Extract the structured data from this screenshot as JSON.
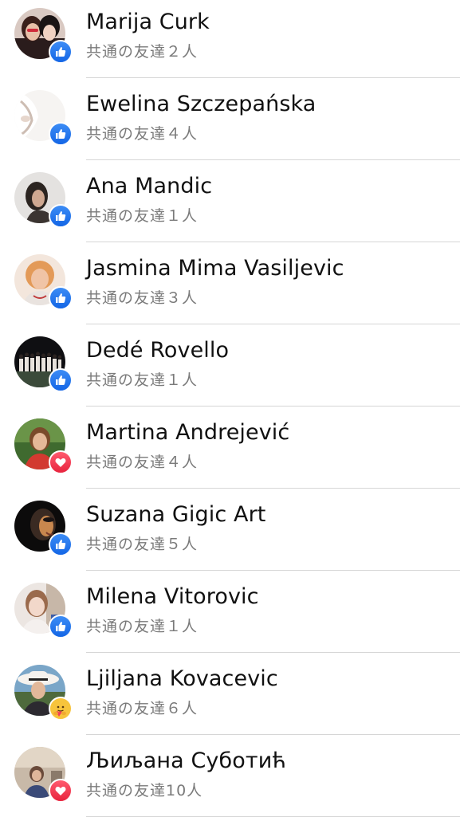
{
  "accent_like": "#1877f2",
  "accent_love": "#f33e58",
  "people": [
    {
      "name": "Marija Curk",
      "mutual": "共通の友達２人",
      "reaction": "like-icon"
    },
    {
      "name": "Ewelina Szczepańska",
      "mutual": "共通の友達４人",
      "reaction": "like-icon"
    },
    {
      "name": "Ana Mandic",
      "mutual": "共通の友達１人",
      "reaction": "like-icon"
    },
    {
      "name": "Jasmina Mima Vasiljevic",
      "mutual": "共通の友達３人",
      "reaction": "like-icon"
    },
    {
      "name": "Dedé Rovello",
      "mutual": "共通の友達１人",
      "reaction": "like-icon"
    },
    {
      "name": "Martina Andrejević",
      "mutual": "共通の友達４人",
      "reaction": "love-icon"
    },
    {
      "name": "Suzana Gigic Art",
      "mutual": "共通の友達５人",
      "reaction": "like-icon"
    },
    {
      "name": "Milena Vitorovic",
      "mutual": "共通の友達１人",
      "reaction": "like-icon"
    },
    {
      "name": "Ljiljana Kovacevic",
      "mutual": "共通の友達６人",
      "reaction": "care-icon"
    },
    {
      "name": "Љиљана Суботић",
      "mutual": "共通の友達10人",
      "reaction": "love-icon"
    }
  ]
}
